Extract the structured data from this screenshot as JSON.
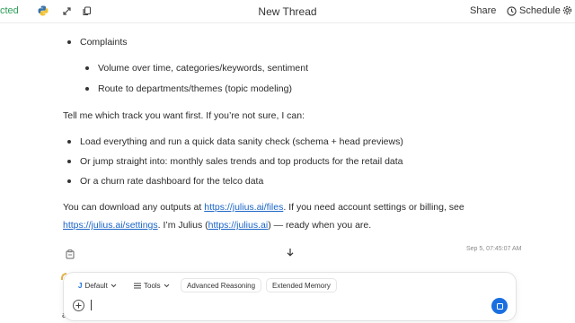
{
  "topbar": {
    "status_text": "cted",
    "title": "New Thread",
    "share_label": "Share",
    "schedule_label": "Schedule",
    "icons": [
      "python-icon",
      "settings-link-icon",
      "copy-icon",
      "clock-icon",
      "gear-icon"
    ]
  },
  "message": {
    "complaints_heading": "Complaints",
    "complaints_items": [
      "Volume over time, categories/keywords, sentiment",
      "Route to departments/themes (topic modeling)"
    ],
    "prompt_line": "Tell me which track you want first. If you’re not sure, I can:",
    "options": [
      "Load everything and run a quick data sanity check (schema + head previews)",
      "Or jump straight into: monthly sales trends and top products for the retail data",
      "Or a churn rate dashboard for the telco data"
    ],
    "download_pre": "You can download any outputs at ",
    "files_link": "https://julius.ai/files",
    "download_post": ". If you need account settings or billing, see",
    "settings_link": "https://julius.ai/settings",
    "julius_pre": ". I’m Julius (",
    "julius_link": "https://julius.ai",
    "julius_post": ") — ready when you are.",
    "timestamp": "Sep 5, 07:45:07 AM"
  },
  "composer": {
    "model_label": "Default",
    "model_letter": "J",
    "tools_label": "Tools",
    "advanced_reasoning_label": "Advanced Reasoning",
    "extended_memory_label": "Extended Memory",
    "input_value": "",
    "peek_char": "a"
  },
  "colors": {
    "link": "#1a64c7",
    "status_green": "#2e9d5b",
    "send_button": "#1a6fe0",
    "model_accent": "#1a6fe0"
  }
}
